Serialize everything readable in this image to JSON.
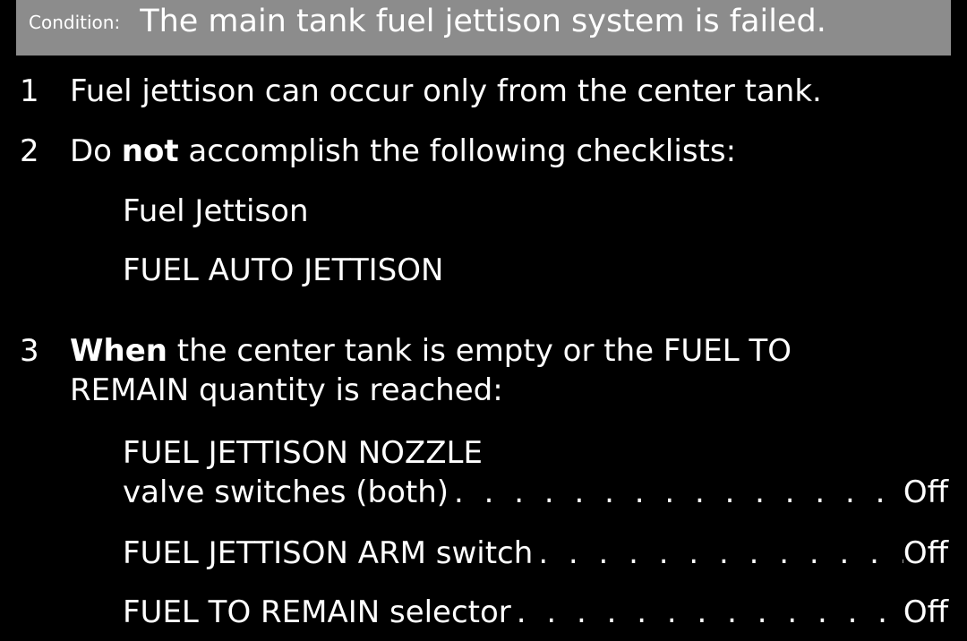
{
  "condition": {
    "label": "Condition:",
    "text": "The main tank fuel jettison system is failed."
  },
  "steps": [
    {
      "number": "1",
      "text": "Fuel jettison can occur only from the center tank."
    },
    {
      "number": "2",
      "text_pre": "Do ",
      "text_bold": "not",
      "text_post": " accomplish the following checklists:",
      "checklists": [
        "Fuel Jettison",
        "FUEL AUTO JETTISON"
      ]
    },
    {
      "number": "3",
      "text_bold": "When",
      "text_line1_post": " the center tank is empty or the FUEL TO",
      "text_line2": "REMAIN quantity is reached:",
      "items": [
        {
          "label_line1": "FUEL JETTISON NOZZLE",
          "label": "valve switches (both)",
          "action": "Off"
        },
        {
          "label": "FUEL JETTISON ARM switch",
          "action": "Off"
        },
        {
          "label": "FUEL TO REMAIN selector",
          "action": "Off"
        }
      ]
    }
  ],
  "colors": {
    "background": "#000000",
    "condition_bar": "#8c8c8c",
    "text": "#ffffff"
  }
}
